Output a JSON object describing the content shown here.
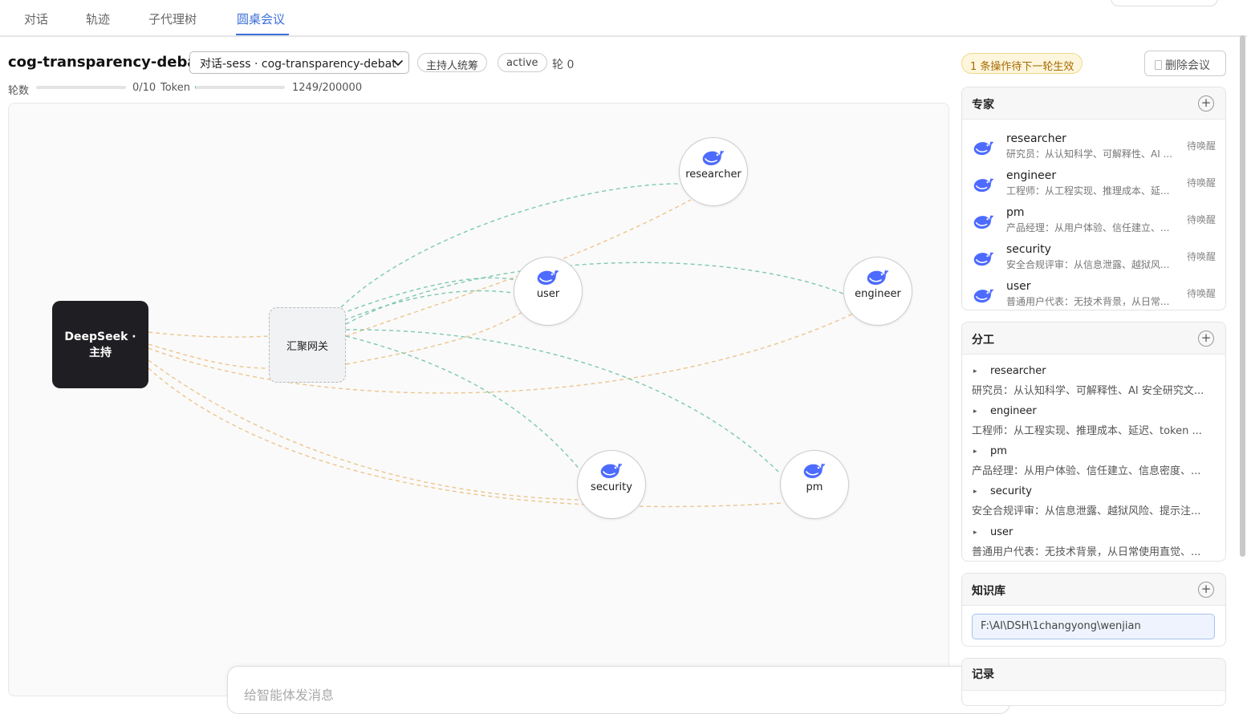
{
  "tabs": [
    {
      "label": "对话"
    },
    {
      "label": "轨迹"
    },
    {
      "label": "子代理树"
    },
    {
      "label": "圆桌会议"
    }
  ],
  "header": {
    "title": "cog-transparency-debate",
    "session_select_value": "对话-sess · cog-transparency-debat",
    "mode_pill": "主持人统筹",
    "status_pill": "active",
    "round_label": "轮 0"
  },
  "progress": {
    "rounds_label": "轮数",
    "rounds_value": "0/10",
    "rounds_fraction": 0.0,
    "token_label": "Token",
    "token_value": "1249/200000",
    "token_fraction": 0.006
  },
  "graph": {
    "host_label": "DeepSeek · 主持",
    "gateway_label": "汇聚网关",
    "nodes": [
      {
        "id": "researcher",
        "label": "researcher"
      },
      {
        "id": "user",
        "label": "user"
      },
      {
        "id": "engineer",
        "label": "engineer"
      },
      {
        "id": "security",
        "label": "security"
      },
      {
        "id": "pm",
        "label": "pm"
      }
    ],
    "link_colors": {
      "host_link": "#ecc58d",
      "gateway_link": "#7ec9ae"
    }
  },
  "composer": {
    "placeholder": "给智能体发消息"
  },
  "right_panel": {
    "pending_notice": "1 条操作待下一轮生效",
    "delete_label": "删除会议",
    "experts_title": "专家",
    "experts": [
      {
        "name": "researcher",
        "desc": "研究员：从认知科学、可解释性、AI ...",
        "status": "待唤醒"
      },
      {
        "name": "engineer",
        "desc": "工程师：从工程实现、推理成本、延...",
        "status": "待唤醒"
      },
      {
        "name": "pm",
        "desc": "产品经理：从用户体验、信任建立、...",
        "status": "待唤醒"
      },
      {
        "name": "security",
        "desc": "安全合规评审：从信息泄露、越狱风...",
        "status": "待唤醒"
      },
      {
        "name": "user",
        "desc": "普通用户代表：无技术背景，从日常...",
        "status": "待唤醒"
      }
    ],
    "roles_title": "分工",
    "roles": [
      {
        "name": "researcher",
        "desc": "研究员：从认知科学、可解释性、AI 安全研究文..."
      },
      {
        "name": "engineer",
        "desc": "工程师：从工程实现、推理成本、延迟、token ..."
      },
      {
        "name": "pm",
        "desc": "产品经理：从用户体验、信任建立、信息密度、..."
      },
      {
        "name": "security",
        "desc": "安全合规评审：从信息泄露、越狱风险、提示注..."
      },
      {
        "name": "user",
        "desc": "普通用户代表：无技术背景，从日常使用直觉、..."
      }
    ],
    "kb_title": "知识库",
    "kb_path": "F:\\AI\\DSH\\1changyong\\wenjian",
    "records_title": "记录"
  },
  "colors": {
    "accent": "#3b6fd8",
    "whale": "#4d6bfe",
    "host_bg": "#1f1f23"
  }
}
